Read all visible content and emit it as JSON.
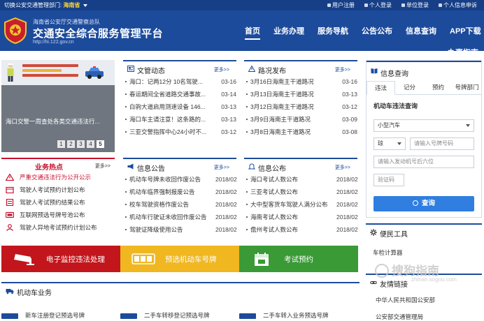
{
  "topbar": {
    "dept_label": "切换公安交通管理部门:",
    "dept_value": "海南省",
    "links": [
      "用户注册",
      "个人登录",
      "单位登录",
      "个人信息申诉"
    ]
  },
  "header": {
    "sub_title": "海南省公安厅交通警察总队",
    "title": "交通安全综合服务管理平台",
    "url": "http://hi.122.gov.cn",
    "nav": [
      "首页",
      "业务办理",
      "服务导航",
      "公告公布",
      "信息查询",
      "APP下载"
    ],
    "nav_overflow": "办事指南"
  },
  "banner": {
    "caption": "海口交警一周查处各类交通违法行...",
    "dots": [
      "1",
      "2",
      "3",
      "4",
      "5"
    ],
    "active_dot": "5"
  },
  "hot": {
    "title": "业务热点",
    "more": "更多>>",
    "items": [
      "严重交通违法行为公开公示",
      "驾驶人考试预约计划公布",
      "驾驶人考试预约结果公布",
      "互联网预选号牌号池公布",
      "驾驶人异地考试预约计划公布"
    ]
  },
  "news": {
    "title": "文管动态",
    "more": "更多>>",
    "items": [
      {
        "t": "海口：记两12分 10名驾驶...",
        "d": "03-16"
      },
      {
        "t": "春运期间全省道路交通事故...",
        "d": "03-14"
      },
      {
        "t": "白驹大道启用测速设备 146...",
        "d": "03-13"
      },
      {
        "t": "海口车主请注意！这条路的...",
        "d": "03-13"
      },
      {
        "t": "三亚交警指挥中心24小时不...",
        "d": "03-12"
      }
    ]
  },
  "roads": {
    "title": "路况发布",
    "more": "更多>>",
    "items": [
      {
        "t": "3月16日海南主干道路况",
        "d": "03-16"
      },
      {
        "t": "3月13日海南主干道路况",
        "d": "03-13"
      },
      {
        "t": "3月12日海南主干道路况",
        "d": "03-12"
      },
      {
        "t": "3月9日海南主干道路况",
        "d": "03-09"
      },
      {
        "t": "3月8日海南主干道路况",
        "d": "03-08"
      }
    ]
  },
  "notice": {
    "title": "信息公告",
    "more": "更多>>",
    "items": [
      {
        "t": "机动车号牌未收回作废公告",
        "d": "2018/02"
      },
      {
        "t": "机动车临界强制报废公告",
        "d": "2018/02"
      },
      {
        "t": "校车驾驶资格作废公告",
        "d": "2018/02"
      },
      {
        "t": "机动车行驶证未收回作废公告",
        "d": "2018/02"
      },
      {
        "t": "驾驶证降级使用公告",
        "d": "2018/02"
      }
    ]
  },
  "publish": {
    "title": "信息公布",
    "more": "更多>>",
    "items": [
      {
        "t": "海口考试人数公布",
        "d": "2018/02"
      },
      {
        "t": "三亚考试人数公布",
        "d": "2018/02"
      },
      {
        "t": "大中型客货车驾驶人满分公布",
        "d": "2018/02"
      },
      {
        "t": "海南考试人数公布",
        "d": "2018/02"
      },
      {
        "t": "儋州考试人数公布",
        "d": "2018/02"
      }
    ]
  },
  "query": {
    "title": "信息查询",
    "tabs": [
      "违法",
      "记分",
      "预约",
      "号牌部门"
    ],
    "active_tab": "违法",
    "subtitle": "机动车违法查询",
    "vehicle_type": "小型汽车",
    "province": "琼",
    "plate_placeholder": "请输入号牌号码",
    "engine_placeholder": "请输入发动机号后六位",
    "captcha_placeholder": "验证码",
    "button": "查询"
  },
  "service": {
    "title": "便民工具",
    "items": [
      "车检计算器"
    ]
  },
  "links": {
    "title": "友情链接",
    "items": [
      "中华人民共和国公安部",
      "公安部交通管理局"
    ]
  },
  "bars": {
    "red": "电子监控违法处理",
    "yellow": "预选机动车号牌",
    "green": "考试预约"
  },
  "vehicle": {
    "title": "机动车业务",
    "items": [
      "新车注册登记预选号牌",
      "二手车转移登记预选号牌",
      "二手车转入业务预选号牌"
    ]
  },
  "watermark": {
    "text": "搜狗指南",
    "url": "zhinan.sogou.com"
  },
  "colors": {
    "brand_blue": "#1d4b9b",
    "hot_red": "#c8102e",
    "bar_red": "#c2161c",
    "bar_yellow": "#f0b721",
    "bar_green": "#3a9a36",
    "query_button": "#2f7ee0"
  }
}
